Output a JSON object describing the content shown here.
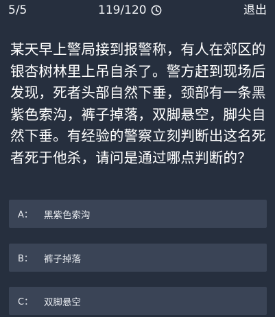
{
  "header": {
    "progress": "5/5",
    "timer": "119/120",
    "exit_label": "退出"
  },
  "question": {
    "text": "某天早上警局接到报警称，有人在郊区的银杏树林里上吊自杀了。警方赶到现场后发现，死者头部自然下垂，颈部有一条黑紫色索沟，裤子掉落，双脚悬空，脚尖自然下垂。有经验的警察立刻判断出这名死者死于他杀，请问是通过哪点判断的？"
  },
  "options": [
    {
      "letter": "A：",
      "text": "黑紫色索沟"
    },
    {
      "letter": "B：",
      "text": "裤子掉落"
    },
    {
      "letter": "C：",
      "text": "双脚悬空"
    }
  ],
  "icons": {
    "timer": "clock-icon"
  },
  "colors": {
    "background": "#262f3e",
    "option_background": "#3a4456",
    "text": "#ffffff"
  }
}
